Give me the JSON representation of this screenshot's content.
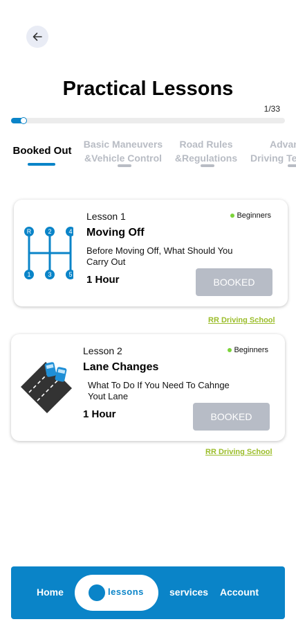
{
  "header": {
    "title": "Practical Lessons",
    "counter": "1/33",
    "progress": 0.03
  },
  "tabs": [
    {
      "label": "Booked Out",
      "active": true
    },
    {
      "label": "Basic Maneuvers\n&Vehicle Control",
      "active": false
    },
    {
      "label": "Road Rules\n&Regulations",
      "active": false
    },
    {
      "label": "Advanced\nDriving Techniques",
      "active": false
    }
  ],
  "lessons": [
    {
      "number": "Lesson 1",
      "level": "Beginners",
      "title": "Moving Off",
      "description": "Before Moving Off, What Should You Carry Out",
      "duration": "1 Hour",
      "button": "BOOKED",
      "school": "RR Driving School",
      "icon": "gear-shift-icon",
      "gear_labels": [
        "R",
        "2",
        "4",
        "1",
        "3",
        "5"
      ]
    },
    {
      "number": "Lesson 2",
      "level": "Beginners",
      "title": "Lane Changes",
      "description": "What To Do If You Need To Cahnge Yout Lane",
      "duration": "1 Hour",
      "button": "BOOKED",
      "school": "RR Driving School",
      "icon": "lane-change-road-icon"
    }
  ],
  "bottom_nav": {
    "home": "Home",
    "lessons": "lessons",
    "services": "services",
    "account": "Account"
  },
  "colors": {
    "accent": "#0a84c8",
    "badge_dot": "#7cd43a",
    "link": "#9bbd2a",
    "button": "#b7bcc6"
  }
}
